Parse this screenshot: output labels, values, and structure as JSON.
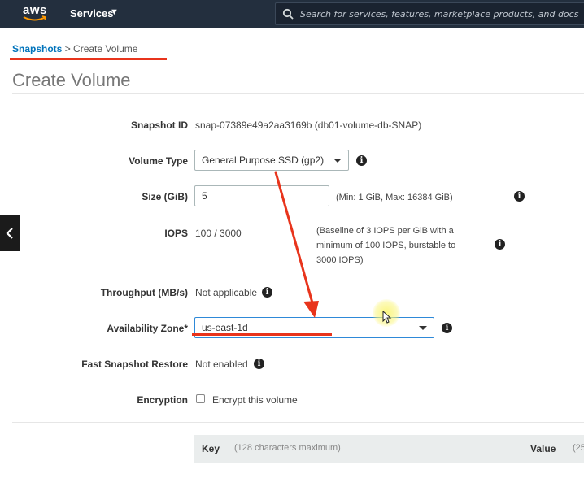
{
  "nav": {
    "logo_text": "aws",
    "services_label": "Services",
    "search_placeholder": "Search for services, features, marketplace products, and docs"
  },
  "breadcrumb": {
    "parent": "Snapshots",
    "separator": ">",
    "current": "Create Volume"
  },
  "page_title": "Create Volume",
  "form": {
    "snapshot_id": {
      "label": "Snapshot ID",
      "value": "snap-07389e49a2aa3169b (db01-volume-db-SNAP)"
    },
    "volume_type": {
      "label": "Volume Type",
      "value": "General Purpose SSD (gp2)"
    },
    "size": {
      "label": "Size (GiB)",
      "value": "5",
      "hint": "(Min: 1 GiB, Max: 16384 GiB)"
    },
    "iops": {
      "label": "IOPS",
      "value": "100 / 3000",
      "hint_lines": [
        "(Baseline of 3 IOPS per GiB with a",
        "minimum of 100 IOPS, burstable to",
        "3000 IOPS)"
      ]
    },
    "throughput": {
      "label": "Throughput (MB/s)",
      "value": "Not applicable"
    },
    "availability_zone": {
      "label": "Availability Zone*",
      "value": "us-east-1d"
    },
    "fast_snapshot_restore": {
      "label": "Fast Snapshot Restore",
      "value": "Not enabled"
    },
    "encryption": {
      "label": "Encryption",
      "checkbox_label": "Encrypt this volume",
      "checked": false
    }
  },
  "tags_table": {
    "key_header": "Key",
    "key_hint": "(128 characters maximum)",
    "value_header": "Value",
    "value_hint": "(25"
  },
  "colors": {
    "nav_bg": "#232f3e",
    "link": "#0073bb",
    "annotation_red": "#e8341c"
  },
  "icons": {
    "info": "i",
    "side_toggle": "chevron-left-icon"
  }
}
